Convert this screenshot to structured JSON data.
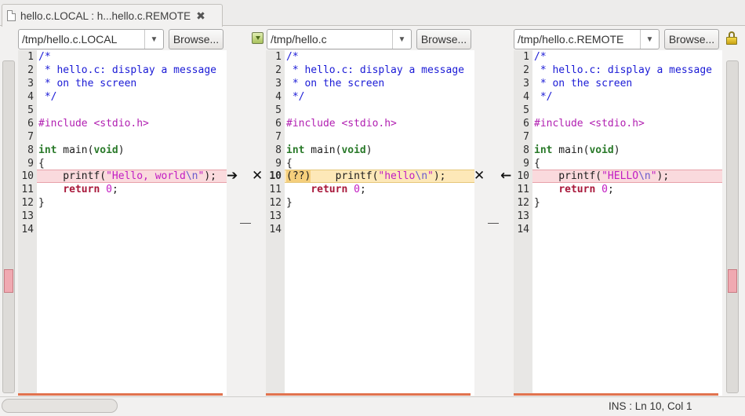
{
  "tab": {
    "title": "hello.c.LOCAL : h...hello.c.REMOTE",
    "close_glyph": "✖"
  },
  "header": {
    "left": {
      "path": "/tmp/hello.c.LOCAL",
      "browse_label": "Browse..."
    },
    "middle": {
      "path": "/tmp/hello.c",
      "browse_label": "Browse..."
    },
    "right": {
      "path": "/tmp/hello.c.REMOTE",
      "browse_label": "Browse..."
    },
    "icons": {
      "save": "save-icon",
      "lock": "lock-icon"
    }
  },
  "panes": {
    "left": {
      "lines": [
        {
          "n": "1"
        },
        {
          "n": "2"
        },
        {
          "n": "3"
        },
        {
          "n": "4"
        },
        {
          "n": "5"
        },
        {
          "n": "6"
        },
        {
          "n": "7"
        },
        {
          "n": "8"
        },
        {
          "n": "9"
        },
        {
          "n": "10"
        },
        {
          "n": "11"
        },
        {
          "n": "12"
        },
        {
          "n": "13"
        },
        {
          "n": "14"
        }
      ],
      "code": {
        "l1": "/*",
        "l2": " * hello.c: display a message",
        "l3": " * on the screen",
        "l4": " */",
        "l6": "#include <stdio.h>",
        "l8_kw": "int",
        "l8_mid": " main(",
        "l8_ty": "void",
        "l8_end": ")",
        "l9": "{",
        "l10_a": "    printf(",
        "l10_s": "\"Hello, world",
        "l10_e": "\\n",
        "l10_q": "\"",
        "l10_b": ");",
        "l11_kw": "return",
        "l11_n": "0",
        "l11_end": ";",
        "l12": "}"
      }
    },
    "middle": {
      "code": {
        "l10_a": "(??)",
        "l10_b": "    printf(",
        "l10_s": "\"hello",
        "l10_e": "\\n",
        "l10_q": "\"",
        "l10_c": ");"
      }
    },
    "right": {
      "code": {
        "l10_a": "    printf(",
        "l10_s": "\"HELLO",
        "l10_e": "\\n",
        "l10_q": "\"",
        "l10_b": ");"
      }
    }
  },
  "markers": {
    "left_arrow": "➔",
    "left_x": "✕",
    "right_x": "✕",
    "right_arrow": "←"
  },
  "status": {
    "text": "INS : Ln 10, Col 1"
  },
  "colors": {
    "conflict_bg": "#fadadd",
    "conflict_border": "#e7a1a9",
    "middle_conflict_bg": "#fde8b8",
    "bottom_bar": "#e1734f"
  }
}
